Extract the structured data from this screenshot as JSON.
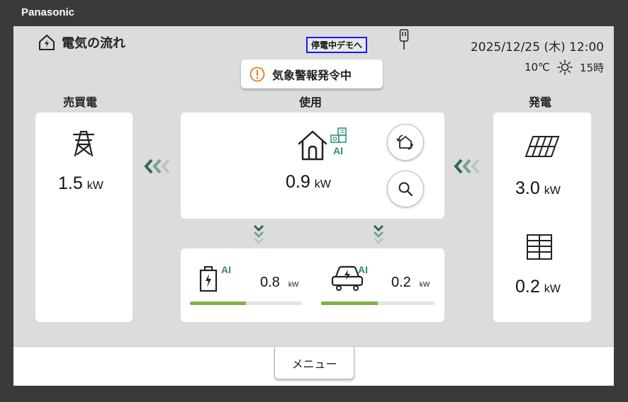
{
  "brand": "Panasonic",
  "header": {
    "title": "電気の流れ",
    "demo_button": "停電中デモへ",
    "datetime": "2025/12/25 (木) 12:00",
    "temperature": "10℃",
    "weather_icon": "sun-icon",
    "hour": "15時"
  },
  "alert": {
    "label": "気象警報発令中",
    "icon": "exclamation-circle-icon",
    "color": "#e67e22"
  },
  "sell": {
    "label": "売買電",
    "value": "1.5",
    "unit": "kW",
    "icon": "power-tower-icon"
  },
  "usage": {
    "label": "使用",
    "value": "0.9",
    "unit": "kW",
    "icon": "house-icon",
    "ai": "AI",
    "battery": {
      "value": "0.8",
      "unit": "kW",
      "ai": "AI",
      "level": 0.5
    },
    "ev": {
      "value": "0.2",
      "unit": "kW",
      "ai": "AI",
      "level": 0.5
    }
  },
  "generation": {
    "label": "発電",
    "solar": {
      "value": "3.0",
      "unit": "kW",
      "icon": "solar-panel-icon"
    },
    "fuelcell": {
      "value": "0.2",
      "unit": "kW",
      "icon": "fuel-cell-icon"
    }
  },
  "footer": {
    "menu": "メニュー"
  },
  "colors": {
    "accent_green": "#7cb342",
    "arrow_dark": "#2e6b50",
    "ai_teal": "#2e8b75",
    "demo_border": "#1a1af0"
  }
}
